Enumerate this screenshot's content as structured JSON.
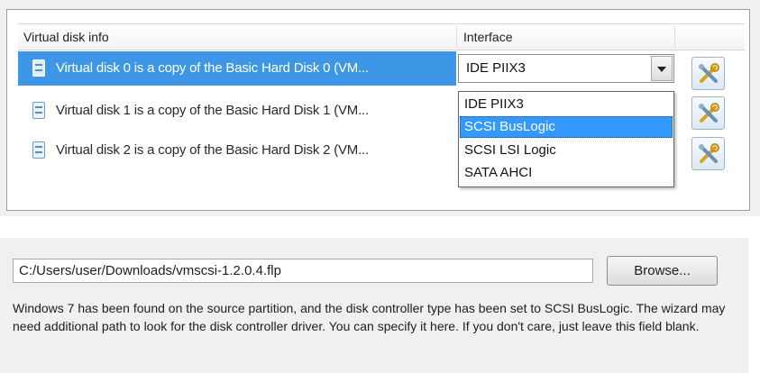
{
  "disk_table": {
    "columns": {
      "info": "Virtual disk info",
      "interface": "Interface"
    },
    "rows": [
      {
        "label": "Virtual disk 0 is a copy of the Basic Hard Disk 0 (VM...",
        "selected": true
      },
      {
        "label": "Virtual disk 1 is a copy of the Basic Hard Disk 1 (VM...",
        "selected": false
      },
      {
        "label": "Virtual disk 2 is a copy of the Basic Hard Disk 2 (VM...",
        "selected": false
      }
    ],
    "row_icon": "disk-icon",
    "settings_icon": "tools-icon"
  },
  "interface_combo": {
    "value": "IDE PIIX3",
    "options": [
      "IDE PIIX3",
      "SCSI BusLogic",
      "SCSI LSI Logic",
      "SATA AHCI"
    ],
    "highlighted": "SCSI BusLogic"
  },
  "driver_path": {
    "value": "C:/Users/user/Downloads/vmscsi-1.2.0.4.flp",
    "browse_label": "Browse..."
  },
  "note": "Windows 7 has been found on the source partition, and the disk controller type has been set to SCSI BusLogic. The wizard may need additional path to look for the disk controller driver. You can specify it here. If you don't care, just leave this field blank.",
  "colors": {
    "selection": "#3d97e6",
    "dropdown_highlight": "#3399ff",
    "panel_bg": "#f0f0f0"
  }
}
